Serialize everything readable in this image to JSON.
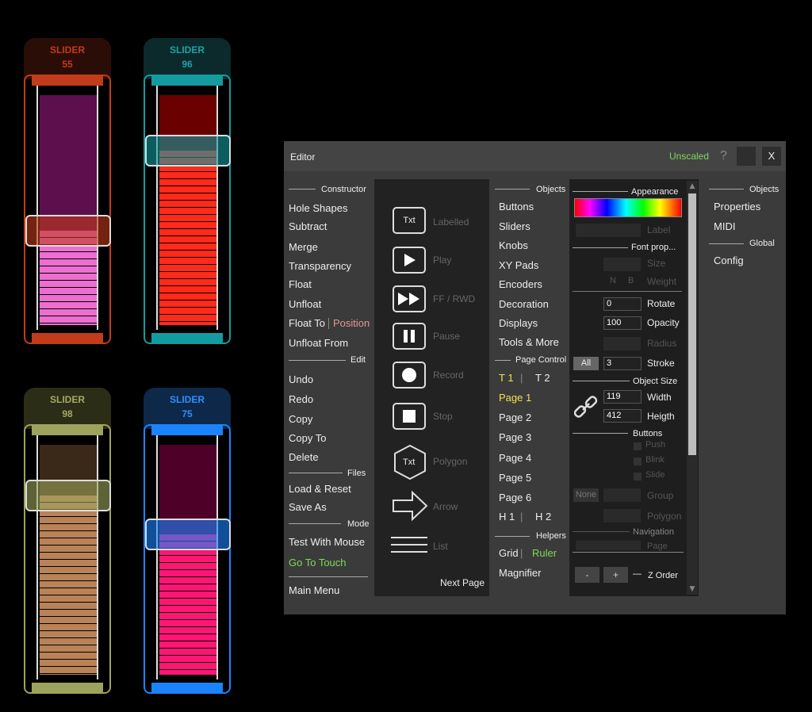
{
  "sliders": [
    {
      "label": "SLIDER",
      "value": "55",
      "level": 0.55,
      "color": "#c23b1a",
      "cap_bg": "#2b0d08",
      "cap_text": "#c23b1a",
      "track_bg": "#5c0f4c",
      "fill": "#ec6fcf"
    },
    {
      "label": "SLIDER",
      "value": "96",
      "level": 0.96,
      "color": "#139ba0",
      "cap_bg": "#0c2a2b",
      "cap_text": "#1aa3a8",
      "track_bg": "#6a0000",
      "fill": "#ff2a1a"
    },
    {
      "label": "SLIDER",
      "value": "98",
      "level": 0.98,
      "color": "#9ca35c",
      "cap_bg": "#2b2d17",
      "cap_text": "#a3a965",
      "track_bg": "#3a2818",
      "fill": "#b98257"
    },
    {
      "label": "SLIDER",
      "value": "75",
      "level": 0.75,
      "color": "#1a84ff",
      "cap_bg": "#0d2849",
      "cap_text": "#2f8fff",
      "track_bg": "#4e0028",
      "fill": "#ff1674"
    }
  ],
  "editor": {
    "title": "Editor",
    "scale_status": "Unscaled",
    "help": "?",
    "close": "X",
    "col1": {
      "constructor_header": "Constructor",
      "hole_shapes": "Hole Shapes",
      "subtract": "Subtract",
      "merge": "Merge",
      "transparency": "Transparency",
      "float": "Float",
      "unfloat": "Unfloat",
      "float_to": "Float To",
      "position": "Position",
      "unfloat_from": "Unfloat From",
      "edit_header": "Edit",
      "undo": "Undo",
      "redo": "Redo",
      "copy": "Copy",
      "copy_to": "Copy To",
      "delete": "Delete",
      "files_header": "Files",
      "load_reset": "Load & Reset",
      "save_as": "Save As",
      "mode_header": "Mode",
      "test_mouse": "Test With Mouse",
      "go_touch": "Go To Touch",
      "main_menu": "Main Menu"
    },
    "shapes": {
      "labelled": "Labelled",
      "labelled_icon": "Txt",
      "play": "Play",
      "ff_rwd": "FF / RWD",
      "pause": "Pause",
      "record": "Record",
      "stop": "Stop",
      "polygon": "Polygon",
      "polygon_icon": "Txt",
      "arrow": "Arrow",
      "list": "List",
      "next_page": "Next Page"
    },
    "col3": {
      "objects_header": "Objects",
      "buttons": "Buttons",
      "sliders": "Sliders",
      "knobs": "Knobs",
      "xy_pads": "XY Pads",
      "encoders": "Encoders",
      "decoration": "Decoration",
      "displays": "Displays",
      "tools_more": "Tools & More",
      "page_control_header": "Page Control",
      "t1": "T 1",
      "t2": "T 2",
      "page1": "Page 1",
      "page2": "Page 2",
      "page3": "Page 3",
      "page4": "Page 4",
      "page5": "Page 5",
      "page6": "Page 6",
      "h1": "H 1",
      "h2": "H 2",
      "sep": "|",
      "helpers_header": "Helpers",
      "grid": "Grid",
      "ruler": "Ruler",
      "magnifier": "Magnifier"
    },
    "props": {
      "appearance_header": "Appearance",
      "label": "Label",
      "font_header": "Font prop...",
      "size": "Size",
      "n": "N",
      "b": "B",
      "weight": "Weight",
      "rotate_value": "0",
      "rotate": "Rotate",
      "opacity_value": "100",
      "opacity": "Opacity",
      "radius": "Radius",
      "all": "All",
      "stroke_value": "3",
      "stroke": "Stroke",
      "object_size_header": "Object Size",
      "width_value": "119",
      "width": "Width",
      "height_value": "412",
      "height": "Heigth",
      "buttons_header": "Buttons",
      "push": "Push",
      "blink": "Blink",
      "slide": "Slide",
      "none": "None",
      "group": "Group",
      "polygon": "Polygon",
      "navigation_header": "Navigation",
      "page": "Page",
      "minus": "-",
      "plus": "+",
      "dash": "—",
      "z_order": "Z Order"
    },
    "col5": {
      "objects_header": "Objects",
      "properties": "Properties",
      "midi": "MIDI",
      "global_header": "Global",
      "config": "Config"
    }
  }
}
